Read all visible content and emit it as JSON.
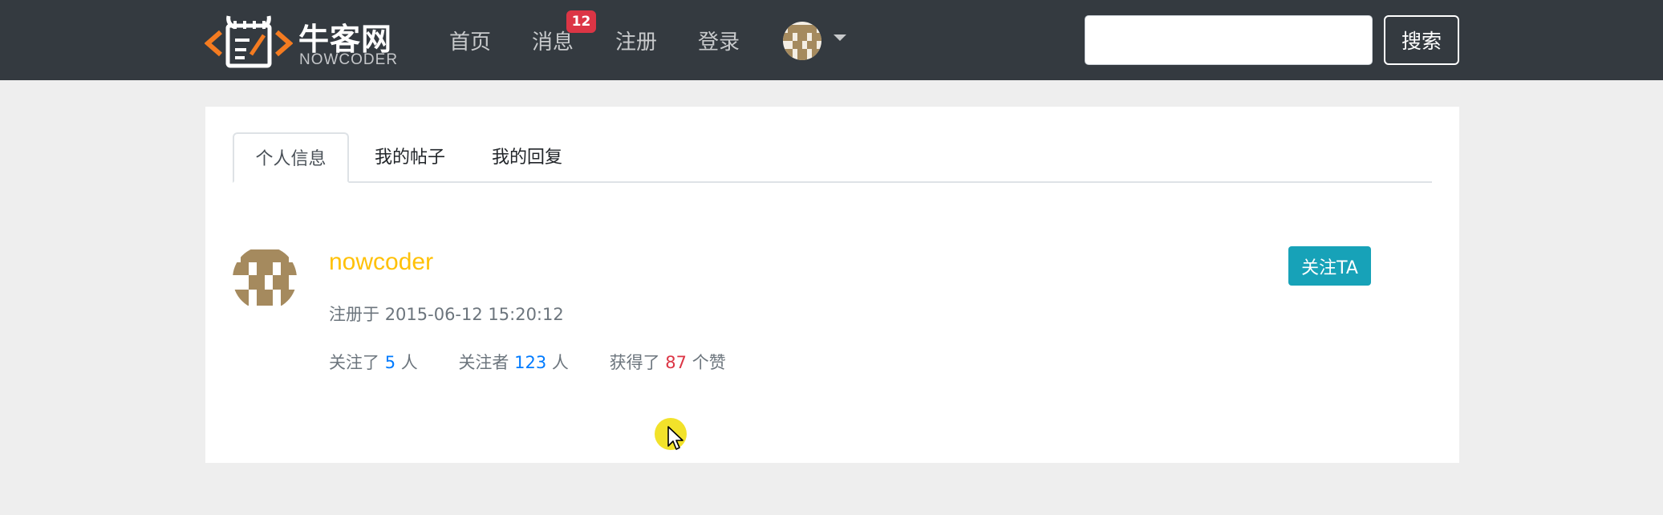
{
  "brand": {
    "name_cn": "牛客网",
    "name_en": "NOWCODER"
  },
  "nav": {
    "links": [
      "首页",
      "消息",
      "注册",
      "登录"
    ],
    "message_badge": "12"
  },
  "search": {
    "placeholder": "",
    "button_label": "搜索"
  },
  "profile": {
    "tabs": [
      "个人信息",
      "我的帖子",
      "我的回复"
    ],
    "active_tab": 0,
    "username": "nowcoder",
    "registered_prefix": "注册于",
    "registered_at": "2015-06-12 15:20:12",
    "follow_button": "关注TA",
    "stats": {
      "following_prefix": "关注了",
      "following_count": "5",
      "following_suffix": "人",
      "followers_prefix": "关注者",
      "followers_count": "123",
      "followers_suffix": "人",
      "likes_prefix": "获得了",
      "likes_count": "87",
      "likes_suffix": "个赞"
    }
  },
  "colors": {
    "navbar": "#343a40",
    "username": "#ffc107",
    "follow_button": "#17a2b8",
    "count_blue": "#007bff",
    "count_red": "#dc3545",
    "badge": "#dc3545",
    "avatar": "#a58a5e"
  },
  "icons": {
    "logo": "nowcoder-logo-icon",
    "avatar": "identicon-avatar-icon",
    "caret": "caret-down-icon",
    "cursor": "mouse-pointer-icon"
  }
}
